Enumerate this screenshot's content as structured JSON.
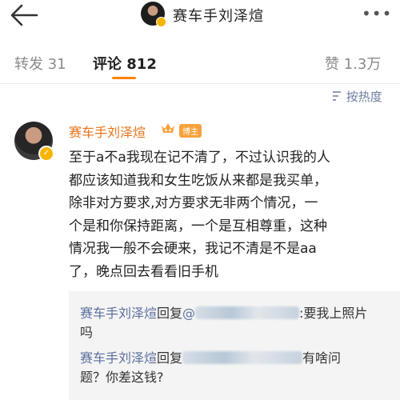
{
  "header": {
    "title": "赛车手刘泽煊"
  },
  "tabs": [
    {
      "label": "转发 31"
    },
    {
      "label": "评论 812"
    },
    {
      "label": "赞 1.3万"
    }
  ],
  "sort": {
    "label": "按热度"
  },
  "comment": {
    "author": "赛车手刘泽煊",
    "badge": "博主",
    "lines": [
      "至于a不a我现在记不清了，不过认识我的人",
      "都应该知道我和女生吃饭从来都是我买单，",
      "除非对方要求,对方要求无非两个情况，一",
      "个是和你保持距离，一个是互相尊重，这种",
      "情况我一般不会硬来，我记不清是不是aa",
      "了，晚点回去看看旧手机"
    ]
  },
  "replies": [
    {
      "author": "赛车手刘泽煊",
      "reply_word": "回复",
      "text_a": ":要我上照片",
      "text_b": "吗"
    },
    {
      "author": "赛车手刘泽煊",
      "reply_word": "回复",
      "text_a": "有啥问",
      "text_b": "题？你差这钱?"
    }
  ],
  "colors": {
    "accent": "#ff8200",
    "name": "#e8741a",
    "link": "#5a6f9e"
  }
}
